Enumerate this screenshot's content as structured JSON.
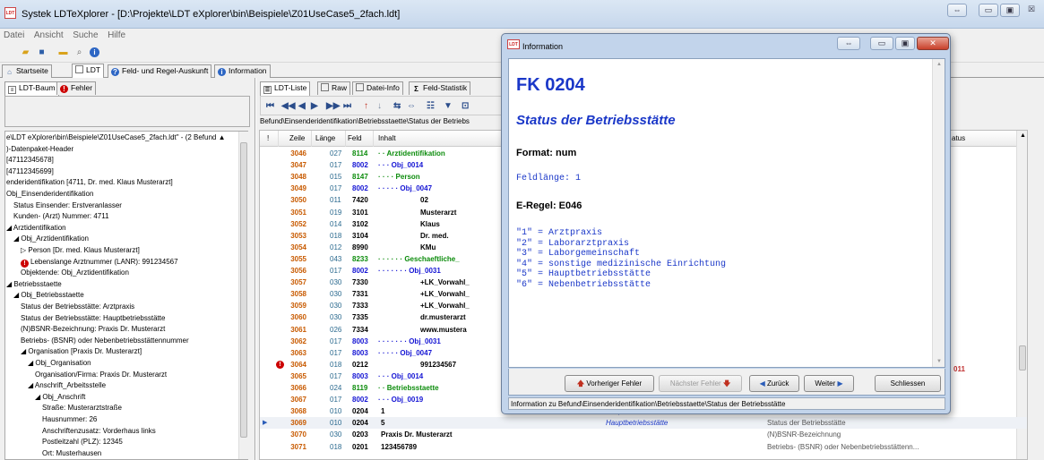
{
  "window": {
    "title": "Systek LDTeXplorer - [D:\\Projekte\\LDT eXplorer\\bin\\Beispiele\\Z01UseCase5_2fach.ldt]",
    "icon": "LDT",
    "btn_restore": "⇔",
    "btn_min": "▭",
    "btn_max": "▣",
    "btn_close": "☒"
  },
  "menu": [
    "Datei",
    "Ansicht",
    "Suche",
    "Hilfe"
  ],
  "toolbar": [
    "open-icon",
    "save-icon",
    "folder-icon",
    "search-icon",
    "info-icon"
  ],
  "tabs": [
    "Startseite",
    "LDT",
    "Feld- und Regel-Auskunft",
    "Information"
  ],
  "left_tabs": [
    "LDT-Baum",
    "Fehler"
  ],
  "tree": [
    {
      "t": "e\\LDT eXplorer\\bin\\Beispiele\\Z01UseCase5_2fach.ldt\" - (2 Befund ▲",
      "i": 0
    },
    {
      "t": ")-Datenpaket-Header",
      "i": 0
    },
    {
      "t": "[47112345678]",
      "i": 0
    },
    {
      "t": "[47112345699]",
      "i": 0
    },
    {
      "t": "enderidentifikation [4711, Dr. med.  Klaus Musterarzt]",
      "i": 0
    },
    {
      "t": "Obj_Einsenderidentifikation",
      "i": 0
    },
    {
      "t": "Status Einsender: Erstveranlasser",
      "i": 1
    },
    {
      "t": "Kunden- (Arzt) Nummer: 4711",
      "i": 1
    },
    {
      "t": "◢ Arztidentifikation",
      "i": 0
    },
    {
      "t": "◢ Obj_Arztidentifikation",
      "i": 1
    },
    {
      "t": "▷ Person [Dr. med.  Klaus Musterarzt]",
      "i": 2
    },
    {
      "t": "Lebenslange Arztnummer (LANR): 991234567",
      "i": 2,
      "err": true
    },
    {
      "t": "Objektende: Obj_Arztidentifikation",
      "i": 2
    },
    {
      "t": "◢ Betriebsstaette",
      "i": 0
    },
    {
      "t": "◢ Obj_Betriebsstaette",
      "i": 1
    },
    {
      "t": "Status der Betriebsstätte: Arztpraxis",
      "i": 2
    },
    {
      "t": "Status der Betriebsstätte: Hauptbetriebsstätte",
      "i": 2
    },
    {
      "t": "(N)BSNR-Bezeichnung: Praxis Dr. Musterarzt",
      "i": 2
    },
    {
      "t": "Betriebs- (BSNR) oder Nebenbetriebsstättennummer",
      "i": 2
    },
    {
      "t": "◢ Organisation [Praxis Dr. Musterarzt]",
      "i": 2
    },
    {
      "t": "◢ Obj_Organisation",
      "i": 3
    },
    {
      "t": "Organisation/Firma: Praxis Dr. Musterarzt",
      "i": 4
    },
    {
      "t": "◢ Anschrift_Arbeitsstelle",
      "i": 3
    },
    {
      "t": "◢ Obj_Anschrift",
      "i": 4
    },
    {
      "t": "Straße: Musterarztstraße",
      "i": 5
    },
    {
      "t": "Hausnummer: 26",
      "i": 5
    },
    {
      "t": "Anschriftenzusatz: Vorderhaus links",
      "i": 5
    },
    {
      "t": "Postleitzahl (PLZ): 12345",
      "i": 5
    },
    {
      "t": "Ort: Musterhausen",
      "i": 5
    }
  ],
  "right_tabs": [
    "LDT-Liste",
    "Raw",
    "Datei-Info",
    "Feld-Statistik"
  ],
  "nav_buttons": [
    "⏮",
    "◀◀",
    "◀",
    "▶",
    "▶▶",
    "⏭",
    "↑",
    "↓",
    "⇆",
    "⇔",
    "☷",
    "▼",
    "⊡"
  ],
  "path": "Befund\\Einsenderidentifikation\\Betriebsstaette\\Status der Betriebs",
  "grid_headers": [
    "!",
    "Zeile",
    "Länge",
    "Feld",
    "Inhalt",
    "atus"
  ],
  "rows": [
    {
      "z": "3046",
      "l": "027",
      "f": "8114",
      "t": "· · Arztidentifikation",
      "cls": "green"
    },
    {
      "z": "3047",
      "l": "017",
      "f": "8002",
      "t": "· · · Obj_0014",
      "cls": "blue"
    },
    {
      "z": "3048",
      "l": "015",
      "f": "8147",
      "t": "· · · · Person",
      "cls": "green"
    },
    {
      "z": "3049",
      "l": "017",
      "f": "8002",
      "t": "· · · · · Obj_0047",
      "cls": "blue"
    },
    {
      "z": "3050",
      "l": "011",
      "f": "7420",
      "t": "02",
      "cls": "",
      "in": 1
    },
    {
      "z": "3051",
      "l": "019",
      "f": "3101",
      "t": "Musterarzt",
      "cls": "",
      "in": 1
    },
    {
      "z": "3052",
      "l": "014",
      "f": "3102",
      "t": "Klaus",
      "cls": "",
      "in": 1
    },
    {
      "z": "3053",
      "l": "018",
      "f": "3104",
      "t": "Dr. med.",
      "cls": "",
      "in": 1
    },
    {
      "z": "3054",
      "l": "012",
      "f": "8990",
      "t": "KMu",
      "cls": "",
      "in": 1
    },
    {
      "z": "3055",
      "l": "043",
      "f": "8233",
      "t": "· · · · · · Geschaeftliche_",
      "cls": "green"
    },
    {
      "z": "3056",
      "l": "017",
      "f": "8002",
      "t": "· · · · · · · Obj_0031",
      "cls": "blue"
    },
    {
      "z": "3057",
      "l": "030",
      "f": "7330",
      "t": "+LK_Vorwahl_",
      "cls": "",
      "in": 2
    },
    {
      "z": "3058",
      "l": "030",
      "f": "7331",
      "t": "+LK_Vorwahl_",
      "cls": "",
      "in": 2
    },
    {
      "z": "3059",
      "l": "030",
      "f": "7333",
      "t": "+LK_Vorwahl_",
      "cls": "",
      "in": 2
    },
    {
      "z": "3060",
      "l": "030",
      "f": "7335",
      "t": "dr.musterarzt",
      "cls": "",
      "in": 2
    },
    {
      "z": "3061",
      "l": "026",
      "f": "7334",
      "t": "www.mustera",
      "cls": "",
      "in": 2
    },
    {
      "z": "3062",
      "l": "017",
      "f": "8003",
      "t": "· · · · · · · Obj_0031",
      "cls": "blue"
    },
    {
      "z": "3063",
      "l": "017",
      "f": "8003",
      "t": "· · · · · Obj_0047",
      "cls": "blue"
    },
    {
      "z": "3064",
      "l": "018",
      "f": "0212",
      "t": "991234567",
      "cls": "",
      "in": 3,
      "err": true
    },
    {
      "z": "3065",
      "l": "017",
      "f": "8003",
      "t": "· · · Obj_0014",
      "cls": "blue"
    },
    {
      "z": "3066",
      "l": "024",
      "f": "8119",
      "t": "· · Betriebsstaette",
      "cls": "green"
    },
    {
      "z": "3067",
      "l": "017",
      "f": "8002",
      "t": "· · · Obj_0019",
      "cls": "blue"
    },
    {
      "z": "3068",
      "l": "010",
      "f": "0204",
      "t": "1",
      "cls": "",
      "in": 4,
      "x1": "Arztpraxis",
      "x2": "Status der Betriebsstätte"
    },
    {
      "z": "3069",
      "l": "010",
      "f": "0204",
      "t": "5",
      "cls": "",
      "in": 4,
      "x1": "Hauptbetriebsstätte",
      "x2": "Status der Betriebsstätte",
      "sel": true
    },
    {
      "z": "3070",
      "l": "030",
      "f": "0203",
      "t": "Praxis Dr. Musterarzt",
      "cls": "",
      "in": 4,
      "x2": "(N)BSNR-Bezeichnung"
    },
    {
      "z": "3071",
      "l": "018",
      "f": "0201",
      "t": "123456789",
      "cls": "",
      "in": 4,
      "x2": "Betriebs- (BSNR) oder Nebenbetriebsstättenn..."
    }
  ],
  "err_code": "011",
  "dialog": {
    "title": "Information",
    "fk": "FK 0204",
    "status": "Status der Betriebsstätte",
    "format": "Format: num",
    "feldlaenge": "Feldlänge: 1",
    "eregel": "E-Regel: E046",
    "codes": [
      "\"1\" = Arztpraxis",
      "\"2\" = Laborarztpraxis",
      "\"3\" = Laborgemeinschaft",
      "\"4\" = sonstige medizinische Einrichtung",
      "\"5\" = Hauptbetriebsstätte",
      "\"6\" = Nebenbetriebsstätte"
    ],
    "prev_error": "Vorheriger Fehler",
    "next_error": "Nächster Fehler",
    "back": "Zurück",
    "forward": "Weiter",
    "close": "Schliessen",
    "statusbar": "Information zu Befund\\Einsenderidentifikation\\Betriebsstaette\\Status der Betriebsstätte"
  },
  "colors": {
    "accent": "#1a37c8",
    "error": "#cc0000",
    "line_number": "#c85a00",
    "tag_green": "#0c8c0c"
  }
}
